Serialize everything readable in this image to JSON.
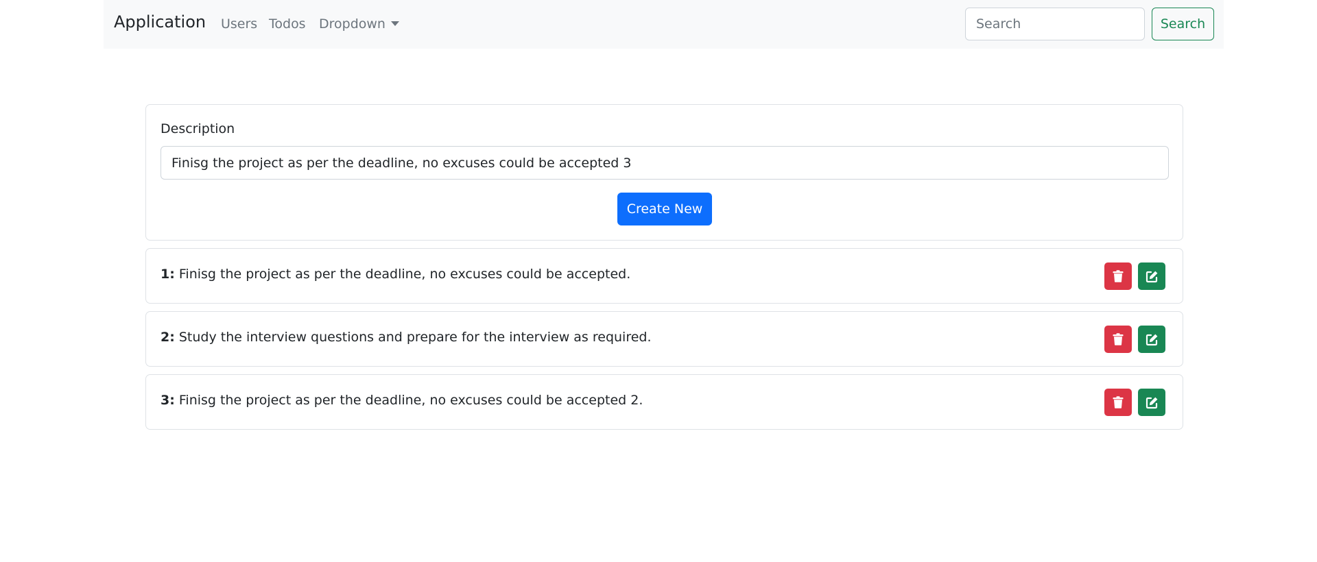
{
  "navbar": {
    "brand": "Application",
    "links": [
      "Users",
      "Todos",
      "Dropdown"
    ],
    "search_placeholder": "Search",
    "search_button": "Search"
  },
  "form": {
    "label": "Description",
    "value": "Finisg the project as per the deadline, no excuses could be accepted 3",
    "create_button": "Create New"
  },
  "todos": [
    {
      "num": "1:",
      "text": "Finisg the project as per the deadline, no excuses could be accepted."
    },
    {
      "num": "2:",
      "text": "Study the interview questions and prepare for the interview as required."
    },
    {
      "num": "3:",
      "text": "Finisg the project as per the deadline, no excuses could be accepted 2."
    }
  ],
  "icons": {
    "delete": "trash-icon",
    "edit": "edit-icon"
  },
  "colors": {
    "primary": "#0d6efd",
    "danger": "#dc3545",
    "success": "#198754",
    "navbar_bg": "#f8f9fa"
  }
}
